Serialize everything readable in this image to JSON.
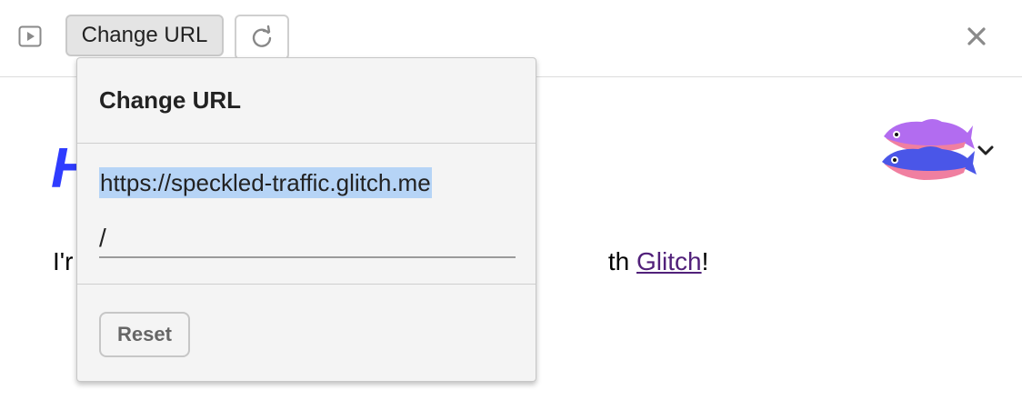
{
  "toolbar": {
    "play_icon": "play-icon",
    "change_url_label": "Change URL",
    "refresh_icon": "refresh-icon",
    "close_icon": "close-icon"
  },
  "page": {
    "heading_visible": "H",
    "text_start": "I'r",
    "text_before_link": "th ",
    "link_text": "Glitch",
    "text_after_link": "!"
  },
  "logo": {
    "icon": "glitch-fish-logo",
    "chevron_icon": "chevron-down-icon"
  },
  "popover": {
    "title": "Change URL",
    "domain": "https://speckled-traffic.glitch.me",
    "path_value": "/",
    "reset_label": "Reset"
  },
  "colors": {
    "heading": "#2f3cff",
    "link": "#51207a",
    "selection": "#b6d4f6",
    "popover_bg": "#f4f4f4"
  }
}
